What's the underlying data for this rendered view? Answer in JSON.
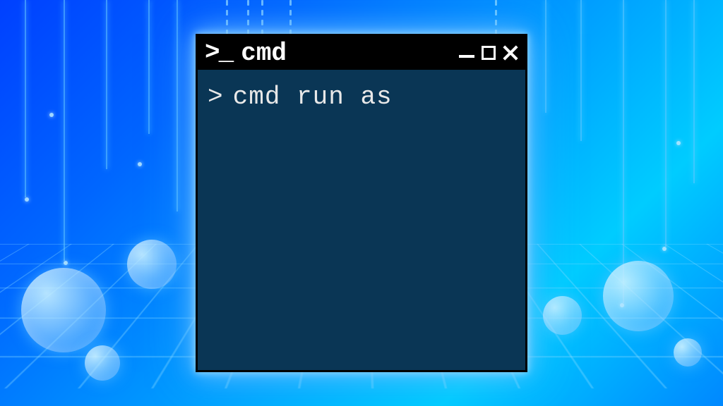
{
  "window": {
    "title": "cmd",
    "icon_text": ">_"
  },
  "terminal": {
    "prompt": ">",
    "command": "cmd run as"
  },
  "colors": {
    "terminal_bg": "#0a3655",
    "titlebar_bg": "#000000",
    "text": "#e8e8e8",
    "glow": "#78c8ff"
  }
}
